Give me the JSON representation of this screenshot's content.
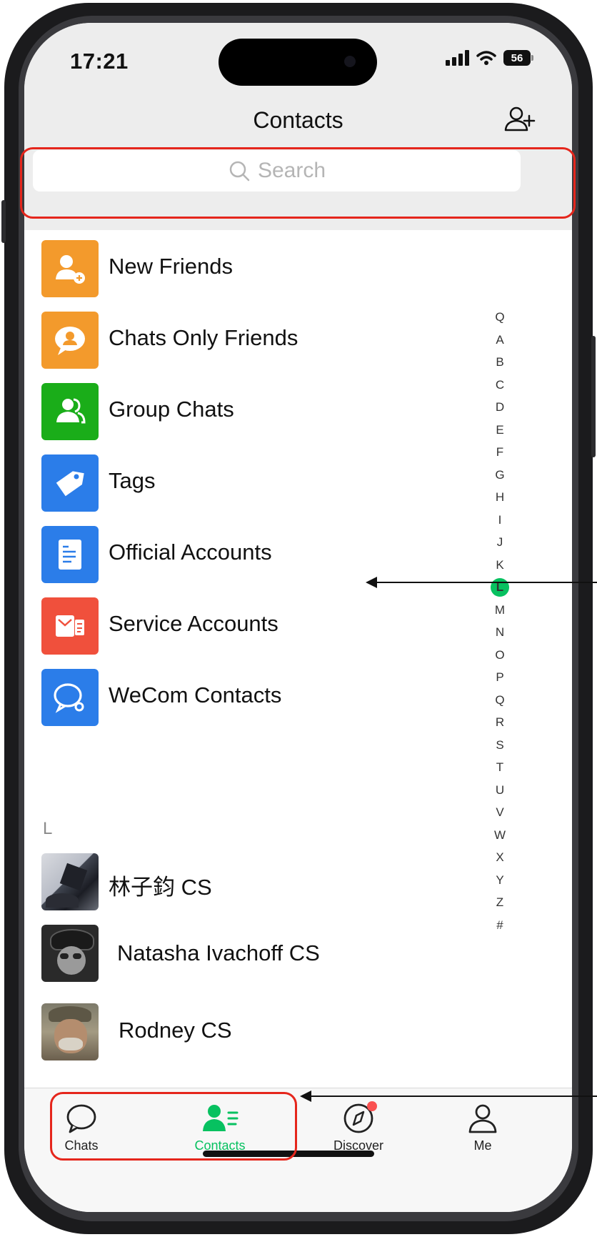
{
  "status_bar": {
    "time": "17:21",
    "battery": "56"
  },
  "header": {
    "title": "Contacts"
  },
  "search": {
    "placeholder": "Search"
  },
  "menu_items": [
    {
      "label": "New Friends",
      "icon": "add-friend-icon",
      "color": "#f39a2c"
    },
    {
      "label": "Chats Only Friends",
      "icon": "chat-person-icon",
      "color": "#f39a2c"
    },
    {
      "label": "Group Chats",
      "icon": "group-icon",
      "color": "#1aad19"
    },
    {
      "label": "Tags",
      "icon": "tag-icon",
      "color": "#2b7de9"
    },
    {
      "label": "Official Accounts",
      "icon": "article-icon",
      "color": "#2b7de9"
    },
    {
      "label": "Service Accounts",
      "icon": "service-icon",
      "color": "#f0503c"
    },
    {
      "label": "WeCom Contacts",
      "icon": "wecom-icon",
      "color": "#2b7de9"
    }
  ],
  "section": {
    "letter": "L"
  },
  "contacts": [
    {
      "name": "林子鈞 CS"
    },
    {
      "name": "Natasha Ivachoff CS"
    },
    {
      "name": "Rodney CS"
    }
  ],
  "index_letters": [
    "Q",
    "A",
    "B",
    "C",
    "D",
    "E",
    "F",
    "G",
    "H",
    "I",
    "J",
    "K",
    "L",
    "M",
    "N",
    "O",
    "P",
    "Q",
    "R",
    "S",
    "T",
    "U",
    "V",
    "W",
    "X",
    "Y",
    "Z",
    "#"
  ],
  "index_active": "L",
  "tabs": [
    {
      "label": "Chats",
      "icon": "chat-bubble-icon"
    },
    {
      "label": "Contacts",
      "icon": "contacts-icon",
      "active": true
    },
    {
      "label": "Discover",
      "icon": "compass-icon"
    },
    {
      "label": "Me",
      "icon": "person-icon"
    }
  ],
  "colors": {
    "accent": "#07c160",
    "highlight": "#e5261c"
  }
}
